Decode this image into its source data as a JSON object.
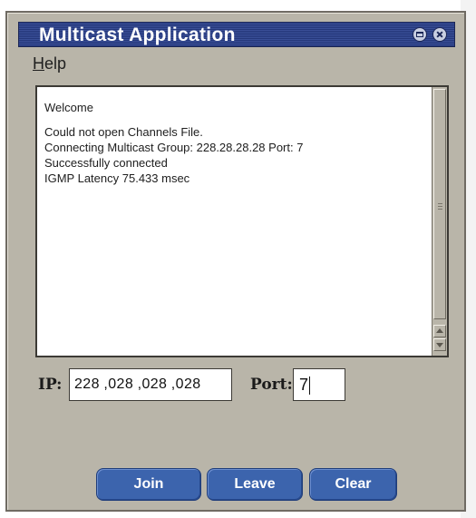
{
  "window": {
    "title": "Multicast Application",
    "colors": {
      "titlebar": "#2c3f86",
      "body": "#b9b5a9",
      "button": "#3c64ad"
    }
  },
  "menu": {
    "items": [
      {
        "mnemonic": "H",
        "rest": "elp"
      }
    ]
  },
  "log": {
    "lines": [
      "Welcome",
      "Could not open Channels File.",
      "Connecting Multicast Group: 228.28.28.28 Port: 7",
      "Successfully connected",
      "IGMP Latency 75.433 msec"
    ]
  },
  "form": {
    "ip_label": "IP:",
    "ip_octets": [
      "228",
      "028",
      "028",
      "028"
    ],
    "ip_separator": ",",
    "port_label": "Port:",
    "port_value": "7"
  },
  "buttons": {
    "join": "Join",
    "leave": "Leave",
    "clear": "Clear"
  },
  "icons": [
    "minimize-maximize-icon",
    "close-icon",
    "scroll-up-arrow-icon",
    "scroll-down-arrow-icon"
  ]
}
